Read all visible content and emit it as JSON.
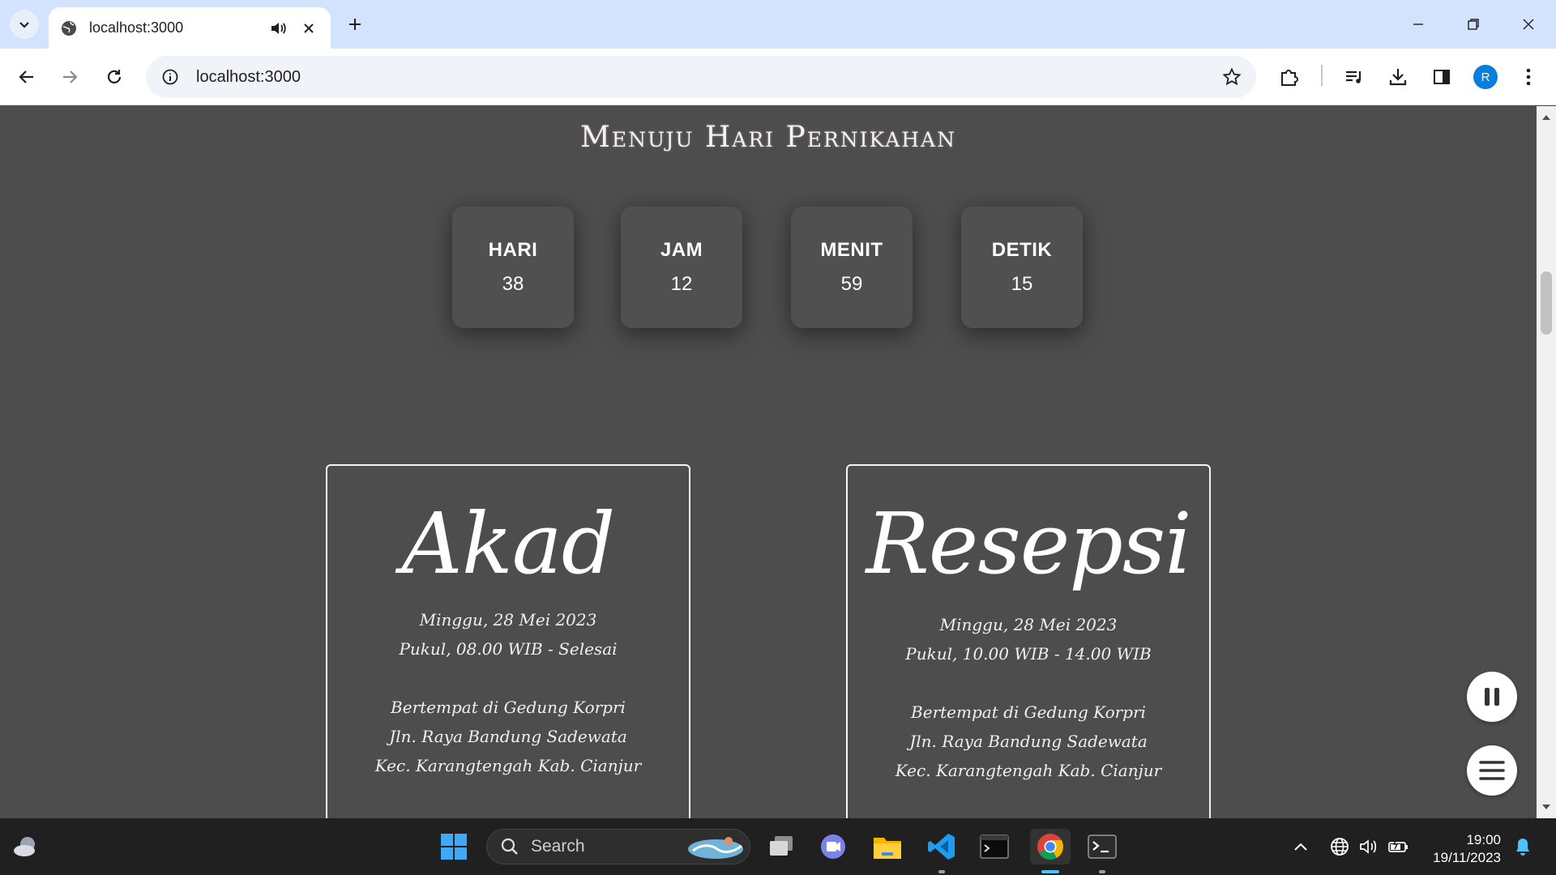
{
  "browser": {
    "tab_title": "localhost:3000",
    "url": "localhost:3000",
    "profile_initial": "R"
  },
  "page": {
    "countdown_title": "Menuju Hari Pernikahan",
    "countdown": [
      {
        "label": "HARI",
        "value": "38"
      },
      {
        "label": "JAM",
        "value": "12"
      },
      {
        "label": "MENIT",
        "value": "59"
      },
      {
        "label": "DETIK",
        "value": "15"
      }
    ],
    "events": [
      {
        "title": "Akad",
        "date": "Minggu, 28 Mei 2023",
        "time": "Pukul, 08.00 WIB - Selesai",
        "venue": "Bertempat di Gedung Korpri",
        "address1": "Jln. Raya Bandung Sadewata",
        "address2": "Kec. Karangtengah Kab. Cianjur"
      },
      {
        "title": "Resepsi",
        "date": "Minggu, 28 Mei 2023",
        "time": "Pukul, 10.00 WIB - 14.00 WIB",
        "venue": "Bertempat di Gedung Korpri",
        "address1": "Jln. Raya Bandung Sadewata",
        "address2": "Kec. Karangtengah Kab. Cianjur"
      }
    ]
  },
  "taskbar": {
    "search_label": "Search",
    "time": "19:00",
    "date": "19/11/2023"
  },
  "colors": {
    "page_bg": "#4d4d4d",
    "tabbar_bg": "#d3e3fd",
    "taskbar_bg": "#202020",
    "accent": "#4cc2ff"
  }
}
